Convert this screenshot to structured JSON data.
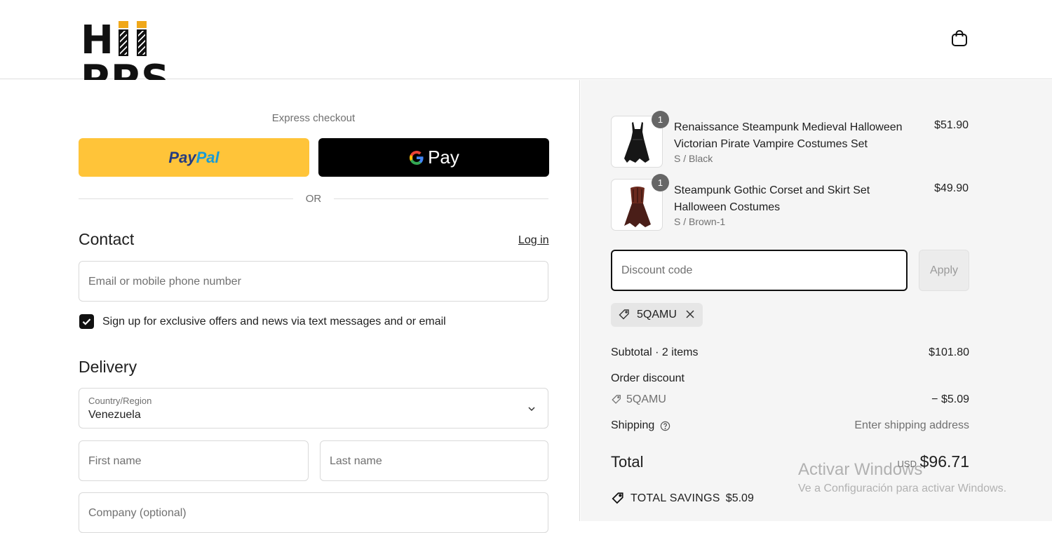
{
  "brand": {
    "logo_text_left": "H",
    "logo_text_right": "PPS"
  },
  "header": {
    "cart_icon": "shopping-bag-icon"
  },
  "express": {
    "title": "Express checkout",
    "paypal_label_a": "Pay",
    "paypal_label_b": "Pal",
    "gpay_label": "Pay",
    "or_label": "OR"
  },
  "contact": {
    "heading": "Contact",
    "login_label": "Log in",
    "email_placeholder": "Email or mobile phone number",
    "signup_label": "Sign up for exclusive offers and news via text messages and or email",
    "signup_checked": true
  },
  "delivery": {
    "heading": "Delivery",
    "country_label": "Country/Region",
    "country_value": "Venezuela",
    "first_name_placeholder": "First name",
    "last_name_placeholder": "Last name",
    "company_placeholder": "Company (optional)"
  },
  "summary": {
    "items": [
      {
        "name": "Renaissance Steampunk Medieval Halloween Victorian Pirate Vampire Costumes Set",
        "variant": "S / Black",
        "price": "$51.90",
        "qty": "1"
      },
      {
        "name": "Steampunk Gothic Corset and Skirt Set Halloween Costumes",
        "variant": "S / Brown-1",
        "price": "$49.90",
        "qty": "1"
      }
    ],
    "discount_placeholder": "Discount code",
    "apply_label": "Apply",
    "applied_code": "5QAMU",
    "subtotal_label": "Subtotal · 2 items",
    "subtotal_value": "$101.80",
    "order_discount_label": "Order discount",
    "discount_code": "5QAMU",
    "discount_value": "− $5.09",
    "shipping_label": "Shipping",
    "shipping_value": "Enter shipping address",
    "total_label": "Total",
    "total_currency": "USD",
    "total_value": "$96.71",
    "savings_label": "TOTAL SAVINGS",
    "savings_value": "$5.09"
  },
  "watermark": {
    "line1": "Activar Windows",
    "line2": "Ve a Configuración para activar Windows."
  },
  "colors": {
    "paypal": "#ffc439",
    "gpay": "#000000",
    "accent": "#111111"
  }
}
